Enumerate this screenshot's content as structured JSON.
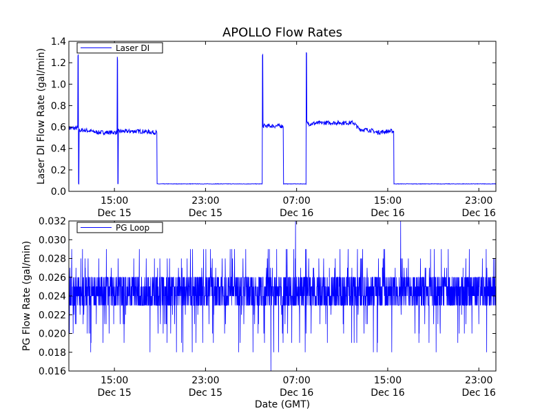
{
  "figure": {
    "title": "APOLLO Flow Rates",
    "xlabel": "Date (GMT)"
  },
  "chart_data": [
    {
      "type": "line",
      "ylabel": "Laser DI Flow Rate (gal/min)",
      "ylim": [
        0.0,
        1.4
      ],
      "yticks": [
        0.0,
        0.2,
        0.4,
        0.6,
        0.8,
        1.0,
        1.2,
        1.4
      ],
      "ytick_labels": [
        "0.0",
        "0.2",
        "0.4",
        "0.6",
        "0.8",
        "1.0",
        "1.2",
        "1.4"
      ],
      "xlim": [
        "2014-12-15 11:00",
        "2014-12-17 00:30"
      ],
      "xtick_labels": [
        {
          "time": "15:00",
          "date": "Dec 15"
        },
        {
          "time": "23:00",
          "date": "Dec 15"
        },
        {
          "time": "07:00",
          "date": "Dec 16"
        },
        {
          "time": "15:00",
          "date": "Dec 16"
        },
        {
          "time": "23:00",
          "date": "Dec 16"
        }
      ],
      "legend": {
        "label": "Laser DI",
        "placement": "top-left"
      },
      "grid": false,
      "color": "#0000ff",
      "series": [
        {
          "name": "Laser DI",
          "x": [
            "2014-12-15 11:00",
            "2014-12-15 11:45",
            "2014-12-15 11:48",
            "2014-12-15 11:51",
            "2014-12-15 11:54",
            "2014-12-15 12:30",
            "2014-12-15 13:30",
            "2014-12-15 14:30",
            "2014-12-15 15:12",
            "2014-12-15 15:15",
            "2014-12-15 15:18",
            "2014-12-15 15:21",
            "2014-12-15 16:30",
            "2014-12-15 17:30",
            "2014-12-15 18:30",
            "2014-12-15 18:42",
            "2014-12-15 18:45",
            "2014-12-15 20:00",
            "2014-12-16 00:00",
            "2014-12-16 03:57",
            "2014-12-16 04:00",
            "2014-12-16 04:03",
            "2014-12-16 04:06",
            "2014-12-16 05:00",
            "2014-12-16 05:48",
            "2014-12-16 05:51",
            "2014-12-16 07:30",
            "2014-12-16 07:48",
            "2014-12-16 07:51",
            "2014-12-16 07:54",
            "2014-12-16 07:57",
            "2014-12-16 09:30",
            "2014-12-16 11:00",
            "2014-12-16 12:00",
            "2014-12-16 12:30",
            "2014-12-16 13:30",
            "2014-12-16 14:00",
            "2014-12-16 15:00",
            "2014-12-16 15:30",
            "2014-12-16 15:33",
            "2014-12-16 17:00",
            "2014-12-16 20:00",
            "2014-12-17 00:00",
            "2014-12-17 00:30"
          ],
          "y": [
            0.59,
            0.59,
            1.26,
            0.07,
            0.57,
            0.57,
            0.55,
            0.55,
            0.55,
            1.24,
            0.07,
            0.56,
            0.56,
            0.56,
            0.55,
            0.55,
            0.07,
            0.07,
            0.07,
            0.07,
            1.27,
            0.6,
            0.61,
            0.61,
            0.61,
            0.07,
            0.07,
            0.07,
            1.28,
            0.64,
            0.63,
            0.64,
            0.64,
            0.64,
            0.58,
            0.57,
            0.55,
            0.56,
            0.56,
            0.07,
            0.07,
            0.07,
            0.07,
            0.07
          ]
        }
      ]
    },
    {
      "type": "line",
      "ylabel": "PG Flow Rate (gal/min)",
      "ylim": [
        0.016,
        0.032
      ],
      "yticks": [
        0.016,
        0.018,
        0.02,
        0.022,
        0.024,
        0.026,
        0.028,
        0.03,
        0.032
      ],
      "ytick_labels": [
        "0.016",
        "0.018",
        "0.020",
        "0.022",
        "0.024",
        "0.026",
        "0.028",
        "0.030",
        "0.032"
      ],
      "xlim": [
        "2014-12-15 11:00",
        "2014-12-17 00:30"
      ],
      "xtick_labels": [
        {
          "time": "15:00",
          "date": "Dec 15"
        },
        {
          "time": "23:00",
          "date": "Dec 15"
        },
        {
          "time": "07:00",
          "date": "Dec 16"
        },
        {
          "time": "15:00",
          "date": "Dec 16"
        },
        {
          "time": "23:00",
          "date": "Dec 16"
        }
      ],
      "legend": {
        "label": "PG Loop",
        "placement": "top-left"
      },
      "grid": false,
      "color": "#0000ff",
      "series": [
        {
          "name": "PG Loop",
          "baseline_band": [
            0.023,
            0.026
          ],
          "min": 0.016,
          "max": 0.032
        }
      ]
    }
  ]
}
